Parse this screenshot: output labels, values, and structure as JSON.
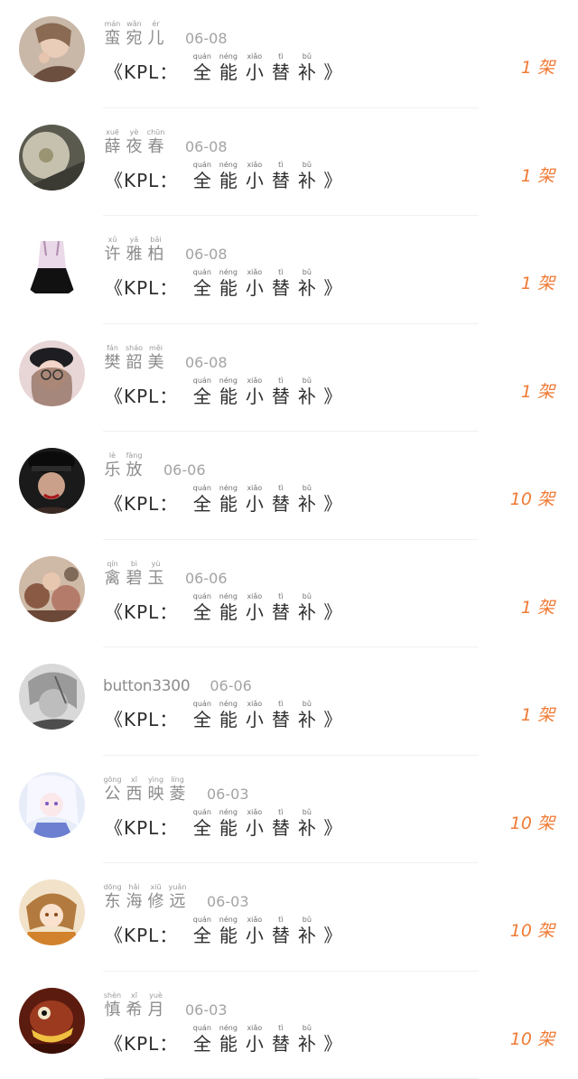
{
  "title_parts": {
    "lead": "《KPL：",
    "chars": [
      {
        "py": "quán",
        "hz": "全"
      },
      {
        "py": "néng",
        "hz": "能"
      },
      {
        "py": "xiǎo",
        "hz": "小"
      },
      {
        "py": "tì",
        "hz": "替"
      },
      {
        "py": "bǔ",
        "hz": "补"
      }
    ],
    "tail": "》"
  },
  "rows": [
    {
      "name": [
        {
          "py": "mán",
          "hz": "蛮"
        },
        {
          "py": "wǎn",
          "hz": "宛"
        },
        {
          "py": "ér",
          "hz": "儿"
        }
      ],
      "date": "06-08",
      "count": "1 架",
      "avatar": "a1"
    },
    {
      "name": [
        {
          "py": "xuē",
          "hz": "薛"
        },
        {
          "py": "yè",
          "hz": "夜"
        },
        {
          "py": "chūn",
          "hz": "春"
        }
      ],
      "date": "06-08",
      "count": "1 架",
      "avatar": "a2"
    },
    {
      "name": [
        {
          "py": "xǔ",
          "hz": "许"
        },
        {
          "py": "yǎ",
          "hz": "雅"
        },
        {
          "py": "bǎi",
          "hz": "柏"
        }
      ],
      "date": "06-08",
      "count": "1 架",
      "avatar": "a3"
    },
    {
      "name": [
        {
          "py": "fán",
          "hz": "樊"
        },
        {
          "py": "sháo",
          "hz": "韶"
        },
        {
          "py": "měi",
          "hz": "美"
        }
      ],
      "date": "06-08",
      "count": "1 架",
      "avatar": "a4"
    },
    {
      "name": [
        {
          "py": "lè",
          "hz": "乐"
        },
        {
          "py": "fàng",
          "hz": "放"
        }
      ],
      "date": "06-06",
      "count": "10 架",
      "avatar": "a5"
    },
    {
      "name": [
        {
          "py": "qín",
          "hz": "禽"
        },
        {
          "py": "bì",
          "hz": "碧"
        },
        {
          "py": "yù",
          "hz": "玉"
        }
      ],
      "date": "06-06",
      "count": "1 架",
      "avatar": "a6"
    },
    {
      "name_text": "button3300",
      "date": "06-06",
      "count": "1 架",
      "avatar": "a7"
    },
    {
      "name": [
        {
          "py": "gōng",
          "hz": "公"
        },
        {
          "py": "xī",
          "hz": "西"
        },
        {
          "py": "yìng",
          "hz": "映"
        },
        {
          "py": "líng",
          "hz": "菱"
        }
      ],
      "date": "06-03",
      "count": "10 架",
      "avatar": "a8"
    },
    {
      "name": [
        {
          "py": "dōng",
          "hz": "东"
        },
        {
          "py": "hǎi",
          "hz": "海"
        },
        {
          "py": "xiū",
          "hz": "修"
        },
        {
          "py": "yuǎn",
          "hz": "远"
        }
      ],
      "date": "06-03",
      "count": "10 架",
      "avatar": "a9"
    },
    {
      "name": [
        {
          "py": "shèn",
          "hz": "慎"
        },
        {
          "py": "xī",
          "hz": "希"
        },
        {
          "py": "yuè",
          "hz": "月"
        }
      ],
      "date": "06-03",
      "count": "10 架",
      "avatar": "a10"
    }
  ],
  "colors": {
    "count": "#f07a34",
    "name": "#8c8c8c",
    "title": "#2f2f2f"
  }
}
